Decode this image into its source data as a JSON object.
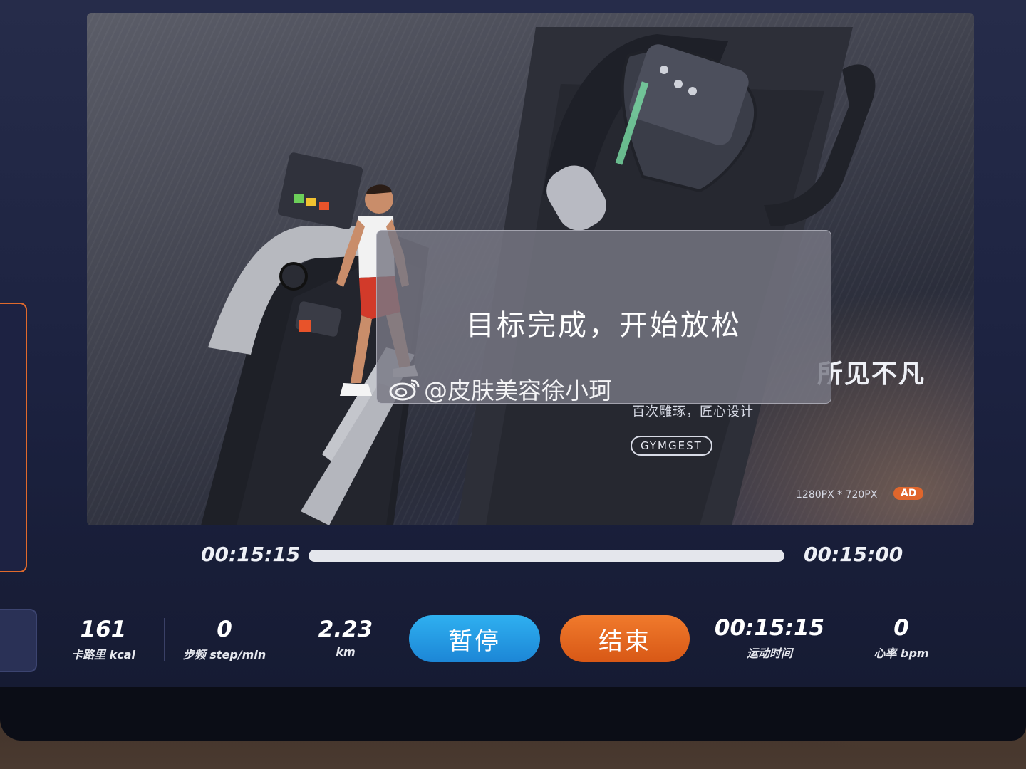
{
  "ad": {
    "headline": "所见不凡",
    "subline": "百次雕琢，匠心设计",
    "brand": "GYMGEST",
    "resolution": "1280PX * 720PX",
    "badge": "AD"
  },
  "dialog": {
    "message": "目标完成，开始放松"
  },
  "watermark": {
    "text": "@皮肤美容徐小珂"
  },
  "progress": {
    "elapsed": "00:15:15",
    "target": "00:15:00",
    "fraction": 1.0
  },
  "stats": {
    "calories": {
      "value": "161",
      "label": "卡路里 kcal"
    },
    "cadence": {
      "value": "0",
      "label": "步频 step/min"
    },
    "distance": {
      "value": "2.23",
      "label": "km"
    },
    "duration": {
      "value": "00:15:15",
      "label": "运动时间"
    },
    "heart_rate": {
      "value": "0",
      "label": "心率 bpm"
    }
  },
  "buttons": {
    "pause": "暂停",
    "end": "结束"
  },
  "colors": {
    "pause_button": "#1c9ce6",
    "end_button": "#e4661e",
    "ad_badge": "#e0662c"
  }
}
